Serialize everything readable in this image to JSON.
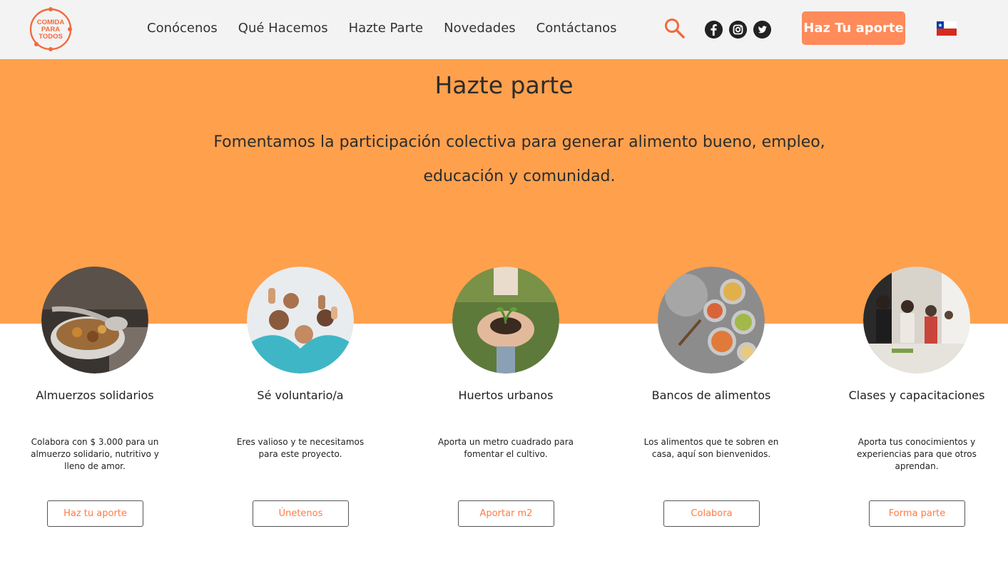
{
  "header": {
    "logo_text": [
      "COMIDA",
      "PARA",
      "TODOS"
    ],
    "nav": [
      "Conócenos",
      "Qué Hacemos",
      "Hazte Parte",
      "Novedades",
      "Contáctanos"
    ],
    "icons": [
      "search-icon",
      "facebook-icon",
      "instagram-icon",
      "twitter-icon",
      "chile-flag-icon"
    ],
    "cta_label": "Haz Tu aporte"
  },
  "hero": {
    "title": "Hazte parte",
    "text": "Fomentamos la participación colectiva para generar alimento bueno, empleo, educación y comunidad."
  },
  "cards": [
    {
      "title": "Almuerzos solidarios",
      "desc": "Colabora con $ 3.000 para un almuerzo solidario, nutritivo y lleno de amor.",
      "button": "Haz tu aporte"
    },
    {
      "title": "Sé voluntario/a",
      "desc": "Eres valioso y te necesitamos para este proyecto.",
      "button": "Únetenos"
    },
    {
      "title": "Huertos urbanos",
      "desc": "Aporta un metro cuadrado para fomentar el cultivo.",
      "button": "Aportar m2"
    },
    {
      "title": "Bancos de alimentos",
      "desc": "Los alimentos que te sobren en casa, aquí son bienvenidos.",
      "button": "Colabora"
    },
    {
      "title": "Clases y capacitaciones",
      "desc": "Aporta tus conocimientos y experiencias para que otros aprendan.",
      "button": "Forma parte"
    }
  ],
  "colors": {
    "accent": "#ff8a5a",
    "hero_bg": "#ffa04d",
    "header_bg": "#f3f3f3",
    "button_text": "#ff7a45"
  }
}
